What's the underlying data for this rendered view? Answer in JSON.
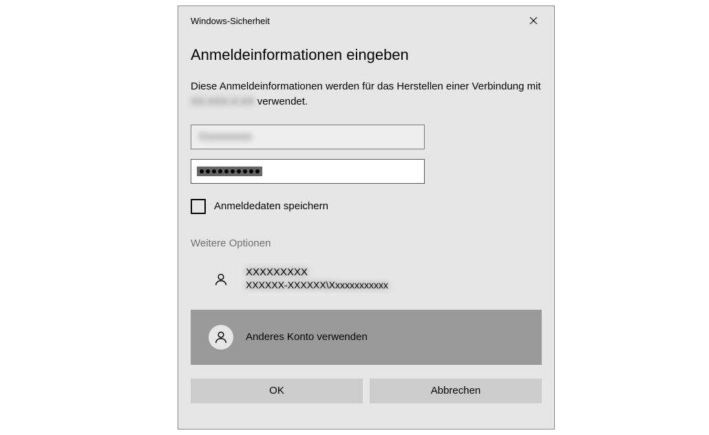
{
  "window": {
    "title": "Windows-Sicherheit"
  },
  "heading": "Anmeldeinformationen eingeben",
  "subtext_prefix": "Diese Anmeldeinformationen werden für das Herstellen einer Verbindung mit ",
  "subtext_server_masked": "XX.XXX.X.XX",
  "subtext_suffix": " verwendet.",
  "username_masked": "Xxxxxxxxxx",
  "password_dot_count": 10,
  "remember_label": "Anmeldedaten speichern",
  "more_options_label": "Weitere Optionen",
  "account_option_masked_line1": "XXXXXXXXX",
  "account_option_masked_line2": "XXXXXX-XXXXXX\\Xxxxxxxxxxxx",
  "use_other_account_label": "Anderes Konto verwenden",
  "buttons": {
    "ok": "OK",
    "cancel": "Abbrechen"
  }
}
